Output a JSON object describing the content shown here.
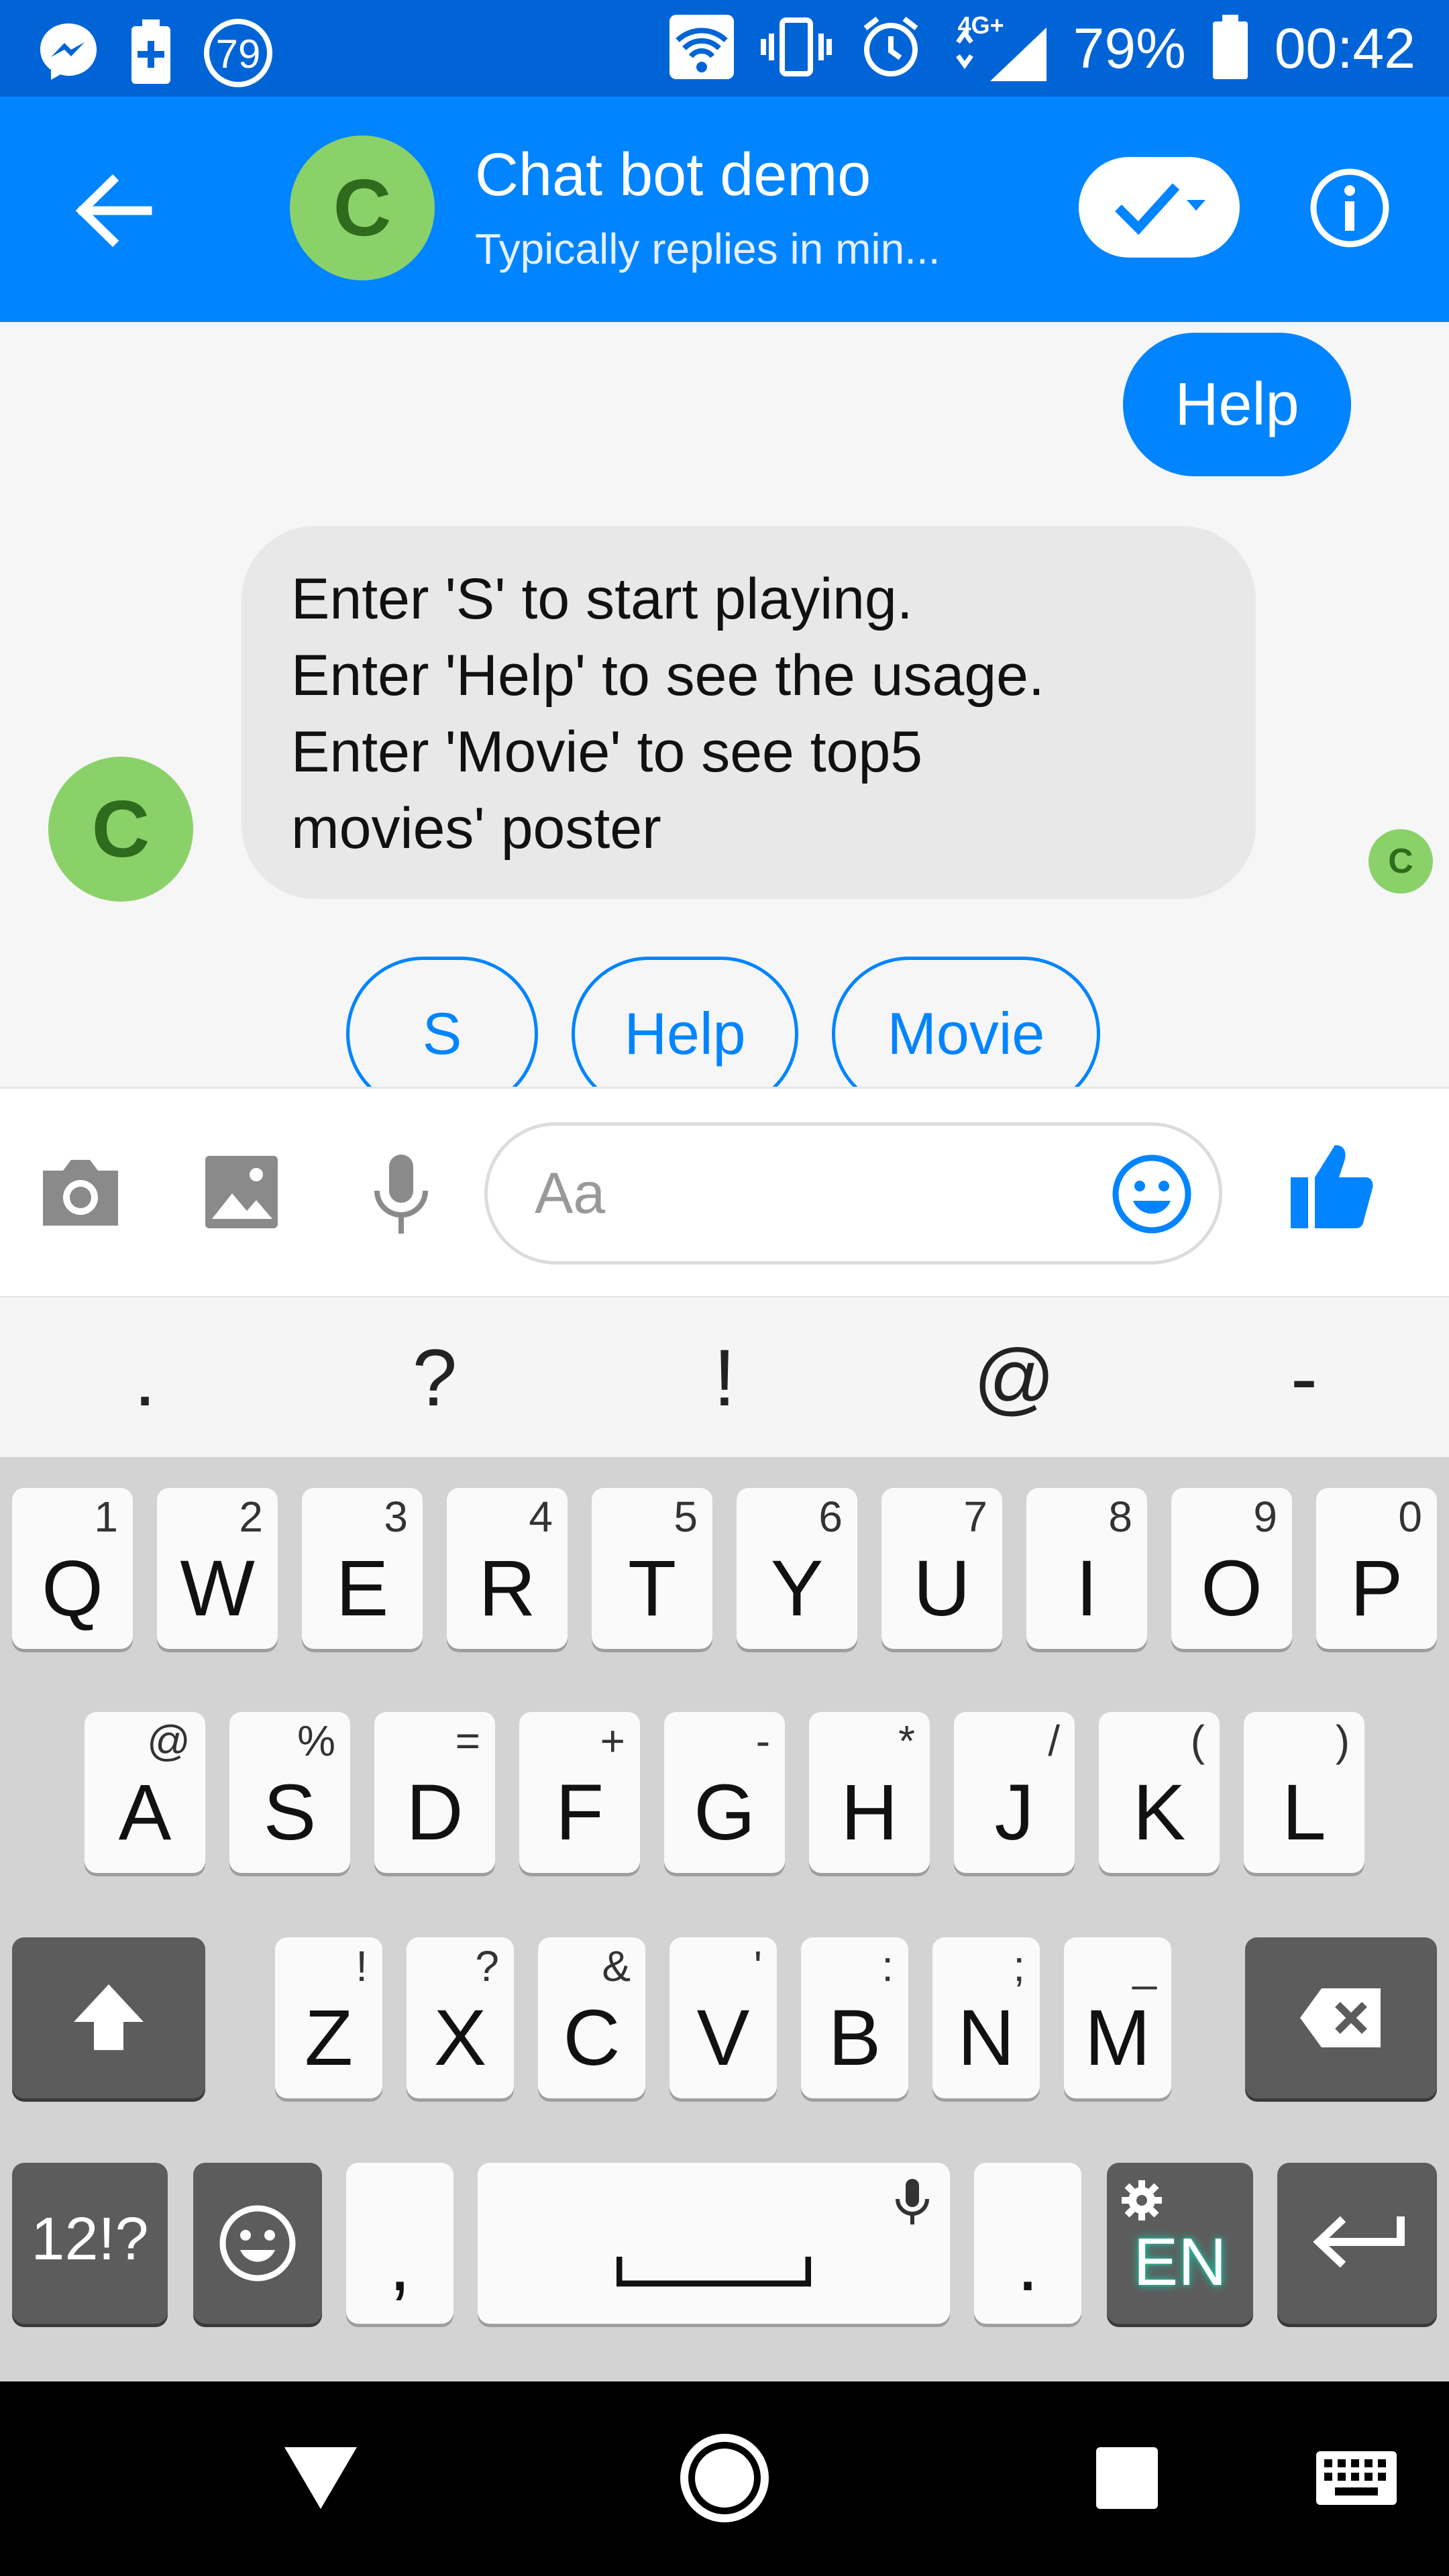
{
  "status_bar": {
    "left_icons": [
      "messenger-icon",
      "battery-saver-icon",
      "notification-count-icon"
    ],
    "notification_count": "79",
    "network_label": "4G+",
    "battery_percent": "79%",
    "time": "00:42"
  },
  "header": {
    "avatar_letter": "C",
    "title": "Chat bot demo",
    "subtitle": "Typically replies in min..."
  },
  "messages": {
    "user_message": "Help",
    "bot_lines": [
      "Enter 'S' to start playing.",
      "Enter 'Help' to see the usage.",
      "Enter 'Movie' to see top5",
      "movies' poster"
    ],
    "bot_avatar_letter": "C",
    "seen_avatar_letter": "C"
  },
  "quick_replies": [
    "S",
    "Help",
    "Movie"
  ],
  "composer": {
    "placeholder": "Aa"
  },
  "suggestions": [
    ".",
    "?",
    "!",
    "@",
    "-"
  ],
  "keyboard": {
    "row1": [
      {
        "key": "Q",
        "hint": "1"
      },
      {
        "key": "W",
        "hint": "2"
      },
      {
        "key": "E",
        "hint": "3"
      },
      {
        "key": "R",
        "hint": "4"
      },
      {
        "key": "T",
        "hint": "5"
      },
      {
        "key": "Y",
        "hint": "6"
      },
      {
        "key": "U",
        "hint": "7"
      },
      {
        "key": "I",
        "hint": "8"
      },
      {
        "key": "O",
        "hint": "9"
      },
      {
        "key": "P",
        "hint": "0"
      }
    ],
    "row2": [
      {
        "key": "A",
        "hint": "@"
      },
      {
        "key": "S",
        "hint": "%"
      },
      {
        "key": "D",
        "hint": "="
      },
      {
        "key": "F",
        "hint": "+"
      },
      {
        "key": "G",
        "hint": "-"
      },
      {
        "key": "H",
        "hint": "*"
      },
      {
        "key": "J",
        "hint": "/"
      },
      {
        "key": "K",
        "hint": "("
      },
      {
        "key": "L",
        "hint": ")"
      }
    ],
    "row3": [
      {
        "key": "Z",
        "hint": "!"
      },
      {
        "key": "X",
        "hint": "?"
      },
      {
        "key": "C",
        "hint": "&"
      },
      {
        "key": "V",
        "hint": "'"
      },
      {
        "key": "B",
        "hint": ":"
      },
      {
        "key": "N",
        "hint": ";"
      },
      {
        "key": "M",
        "hint": "_"
      }
    ],
    "symbols_label": "12!?",
    "comma": ",",
    "period": ".",
    "language": "EN",
    "accent_color": "#19c9a8"
  },
  "colors": {
    "status_bar": "#0064d6",
    "app_bar": "#0084ff",
    "avatar": "#8bd16a"
  }
}
